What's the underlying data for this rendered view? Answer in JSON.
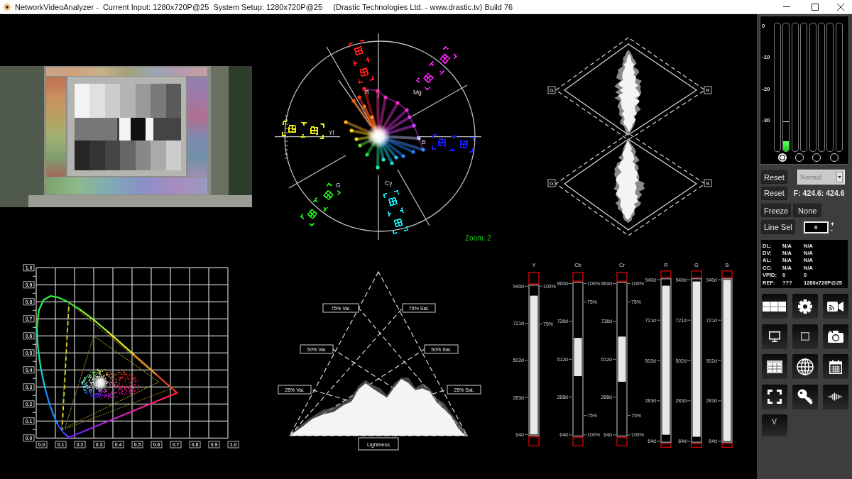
{
  "window": {
    "title": "NetworkVideoAnalyzer -  Current Input: 1280x720P@25  System Setup: 1280x720P@25     (Drastic Technologies Ltd. - www.drastic.tv) Build 76"
  },
  "vectorscope": {
    "targets": [
      {
        "label": "R",
        "color": "#ff1a1a"
      },
      {
        "label": "Mg",
        "color": "#f01cf0"
      },
      {
        "label": "B",
        "color": "#1a1aff"
      },
      {
        "label": "Cy",
        "color": "#18e0e8"
      },
      {
        "label": "G",
        "color": "#18e018"
      },
      {
        "label": "Yl",
        "color": "#f0f018"
      }
    ],
    "zoom_label": "Zoom: 2"
  },
  "diamond_scope": {
    "corner_labels": [
      "G",
      "R",
      "G",
      "B"
    ]
  },
  "chromaticity": {
    "y_labels": [
      "1.0",
      "0.9",
      "0.8",
      "0.7",
      "0.6",
      "0.5",
      "0.4",
      "0.3",
      "0.2",
      "0.1",
      "0.0"
    ],
    "x_labels": [
      "0.0",
      "0.1",
      "0.2",
      "0.3",
      "0.4",
      "0.5",
      "0.6",
      "0.7",
      "0.8",
      "0.9",
      "1.0"
    ]
  },
  "hsl_triangle": {
    "labels": [
      "75% Val.",
      "75% Sat.",
      "50% Val.",
      "50% Sat.",
      "25% Val.",
      "25% Sat."
    ],
    "axis_label": "Lightness"
  },
  "component_meters": {
    "yuv": [
      {
        "chart_data": {
          "type": "candlestick",
          "categories": [
            "Y"
          ],
          "series": [
            {
              "ohlc": [
                [
                  64,
                  884,
                  64,
                  884
                ]
              ]
            }
          ],
          "ylim": [
            64,
            940
          ],
          "yticks": [
            {
              "value": 940,
              "label": "940d"
            },
            {
              "value": 721,
              "label": "721d"
            },
            {
              "value": 502,
              "label": "502d"
            },
            {
              "value": 283,
              "label": "283d"
            },
            {
              "value": 64,
              "label": "64d"
            }
          ]
        },
        "percent_marks": [
          "100%",
          "75%"
        ]
      },
      {
        "chart_data": {
          "type": "candlestick",
          "categories": [
            "Cb"
          ],
          "series": [
            {
              "ohlc": [
                [
                  412,
                  638,
                  412,
                  638
                ]
              ]
            }
          ],
          "ylim": [
            64,
            960
          ],
          "yticks": [
            {
              "value": 960,
              "label": "960d"
            },
            {
              "value": 736,
              "label": "736d"
            },
            {
              "value": 512,
              "label": "512d"
            },
            {
              "value": 288,
              "label": "288d"
            },
            {
              "value": 64,
              "label": "64d"
            }
          ]
        },
        "percent_marks": [
          "100%",
          "75%",
          "75%",
          "100%"
        ]
      },
      {
        "chart_data": {
          "type": "candlestick",
          "categories": [
            "Cr"
          ],
          "series": [
            {
              "ohlc": [
                [
                  379,
                  646,
                  379,
                  646
                ]
              ]
            }
          ],
          "ylim": [
            64,
            960
          ],
          "yticks": [
            {
              "value": 960,
              "label": "960d"
            },
            {
              "value": 736,
              "label": "736d"
            },
            {
              "value": 512,
              "label": "512d"
            },
            {
              "value": 288,
              "label": "288d"
            },
            {
              "value": 64,
              "label": "64d"
            }
          ]
        },
        "percent_marks": [
          "100%",
          "75%",
          "75%",
          "100%"
        ]
      }
    ],
    "rgb": [
      {
        "chart_data": {
          "type": "candlestick",
          "categories": [
            "R"
          ],
          "series": [
            {
              "ohlc": [
                [
                  99,
                  908,
                  99,
                  908
                ]
              ]
            }
          ],
          "ylim": [
            64,
            940
          ],
          "yticks": [
            {
              "value": 940,
              "label": "940d"
            },
            {
              "value": 721,
              "label": "721d"
            },
            {
              "value": 502,
              "label": "502d"
            },
            {
              "value": 283,
              "label": "283d"
            },
            {
              "value": 64,
              "label": "64d"
            }
          ]
        }
      },
      {
        "chart_data": {
          "type": "candlestick",
          "categories": [
            "G"
          ],
          "series": [
            {
              "ohlc": [
                [
                  88,
                  931,
                  88,
                  931
                ]
              ]
            }
          ],
          "ylim": [
            64,
            940
          ],
          "yticks": [
            {
              "value": 940,
              "label": "940d"
            },
            {
              "value": 721,
              "label": "721d"
            },
            {
              "value": 502,
              "label": "502d"
            },
            {
              "value": 283,
              "label": "283d"
            },
            {
              "value": 64,
              "label": "64d"
            }
          ]
        }
      },
      {
        "chart_data": {
          "type": "candlestick",
          "categories": [
            "B"
          ],
          "series": [
            {
              "ohlc": [
                [
                  64,
                  940,
                  64,
                  940
                ]
              ]
            }
          ],
          "ylim": [
            64,
            940
          ],
          "yticks": [
            {
              "value": 940,
              "label": "940d"
            },
            {
              "value": 721,
              "label": "721d"
            },
            {
              "value": 502,
              "label": "502d"
            },
            {
              "value": 283,
              "label": "283d"
            },
            {
              "value": 64,
              "label": "64d"
            }
          ]
        }
      }
    ]
  },
  "audio": {
    "scale": [
      "0",
      "-10",
      "-20",
      "-30"
    ],
    "pairs": [
      {
        "selected": true,
        "right": {
          "level": 0.08,
          "peak": {
            "level": 0.23
          }
        }
      },
      {
        "selected": false
      },
      {
        "selected": false
      },
      {
        "selected": false
      }
    ]
  },
  "controls": {
    "mode": {
      "button": "Reset",
      "dropdown": "Normal"
    },
    "frequency": {
      "button": "Reset",
      "readout": "F: 424.6: 424.6"
    },
    "freeze": {
      "button": "Freeze",
      "source": "None"
    },
    "line_select": {
      "button": "Line Sel",
      "value": "0",
      "increment": "+",
      "decrement": "-"
    }
  },
  "signal_info": {
    "rows": [
      {
        "label": "DL:",
        "values": [
          "N/A",
          "N/A"
        ]
      },
      {
        "label": "DV:",
        "values": [
          "N/A",
          "N/A"
        ]
      },
      {
        "label": "AL:",
        "values": [
          "N/A",
          "N/A"
        ]
      },
      {
        "label": "CC:",
        "values": [
          "N/A",
          "N/A"
        ]
      },
      {
        "label": "VPID:",
        "values": [
          "0",
          "0"
        ]
      },
      {
        "label": "REF:",
        "values": [
          "???",
          "1280x720P@25"
        ]
      }
    ]
  },
  "expand_button": {
    "label": "V"
  }
}
